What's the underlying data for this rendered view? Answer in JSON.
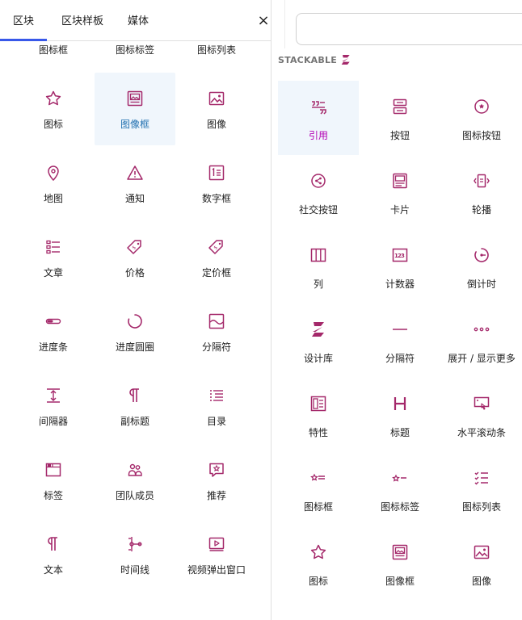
{
  "tabs": [
    {
      "label": "区块",
      "active": true
    },
    {
      "label": "区块样板",
      "active": false
    },
    {
      "label": "媒体",
      "active": false
    }
  ],
  "close_label": "×",
  "accent_color": "#3858e9",
  "icon_color": "#a4286a",
  "left_blocks": [
    {
      "label": "图标框",
      "icon": "icon-box-icon"
    },
    {
      "label": "图标标签",
      "icon": "icon-label-icon"
    },
    {
      "label": "图标列表",
      "icon": "icon-list-icon"
    },
    {
      "label": "图标",
      "icon": "star-icon"
    },
    {
      "label": "图像框",
      "icon": "image-box-icon",
      "selected": true
    },
    {
      "label": "图像",
      "icon": "image-icon"
    },
    {
      "label": "地图",
      "icon": "map-pin-icon"
    },
    {
      "label": "通知",
      "icon": "warning-icon"
    },
    {
      "label": "数字框",
      "icon": "number-box-icon"
    },
    {
      "label": "文章",
      "icon": "posts-icon"
    },
    {
      "label": "价格",
      "icon": "price-tag-icon"
    },
    {
      "label": "定价框",
      "icon": "pricing-box-icon"
    },
    {
      "label": "进度条",
      "icon": "progress-bar-icon"
    },
    {
      "label": "进度圆圈",
      "icon": "progress-circle-icon"
    },
    {
      "label": "分隔符",
      "icon": "separator-icon"
    },
    {
      "label": "间隔器",
      "icon": "spacer-icon"
    },
    {
      "label": "副标题",
      "icon": "pilcrow-icon"
    },
    {
      "label": "目录",
      "icon": "table-of-contents-icon"
    },
    {
      "label": "标签",
      "icon": "tabs-icon"
    },
    {
      "label": "团队成员",
      "icon": "team-member-icon"
    },
    {
      "label": "推荐",
      "icon": "testimonial-icon"
    },
    {
      "label": "文本",
      "icon": "text-pilcrow-icon"
    },
    {
      "label": "时间线",
      "icon": "timeline-icon"
    },
    {
      "label": "视频弹出窗口",
      "icon": "video-popup-icon"
    }
  ],
  "stackable": {
    "title": "STACKABLE",
    "blocks": [
      {
        "label": "引用",
        "icon": "quote-icon",
        "selected": true
      },
      {
        "label": "按钮",
        "icon": "button-icon"
      },
      {
        "label": "图标按钮",
        "icon": "icon-button-icon"
      },
      {
        "label": "社交按钮",
        "icon": "share-icon"
      },
      {
        "label": "卡片",
        "icon": "card-icon"
      },
      {
        "label": "轮播",
        "icon": "carousel-icon"
      },
      {
        "label": "列",
        "icon": "columns-icon"
      },
      {
        "label": "计数器",
        "icon": "counter-icon"
      },
      {
        "label": "倒计时",
        "icon": "countdown-icon"
      },
      {
        "label": "设计库",
        "icon": "stackable-logo-icon"
      },
      {
        "label": "分隔符",
        "icon": "divider-line-icon"
      },
      {
        "label": "展开 / 显示更多",
        "icon": "dots-icon"
      },
      {
        "label": "特性",
        "icon": "feature-icon"
      },
      {
        "label": "标题",
        "icon": "heading-h-icon"
      },
      {
        "label": "水平滚动条",
        "icon": "horizontal-scroller-icon"
      },
      {
        "label": "图标框",
        "icon": "icon-box-icon"
      },
      {
        "label": "图标标签",
        "icon": "icon-label-icon"
      },
      {
        "label": "图标列表",
        "icon": "icon-list-icon"
      },
      {
        "label": "图标",
        "icon": "star-icon"
      },
      {
        "label": "图像框",
        "icon": "image-box-icon"
      },
      {
        "label": "图像",
        "icon": "image-icon"
      }
    ]
  }
}
